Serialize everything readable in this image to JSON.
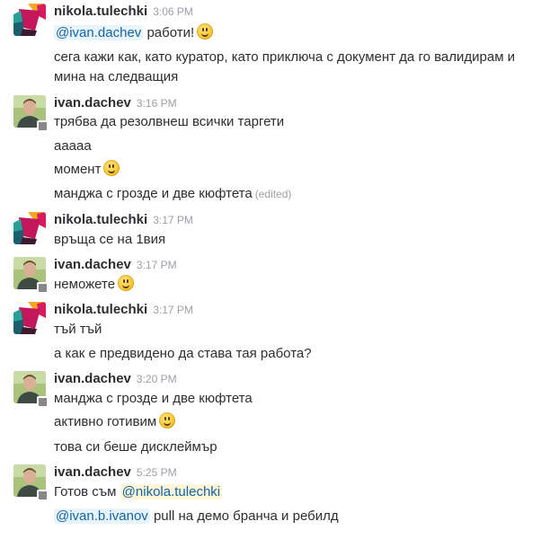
{
  "users": {
    "nikola": "nikola.tulechki",
    "ivan": "ivan.dachev"
  },
  "groups": [
    {
      "time": "3:06 PM",
      "lines": [
        {
          "mention": "@ivan.dachev",
          "text": " работи!",
          "emoji": "slightly-smiling-face"
        },
        {
          "text": "сега кажи как, като куратор, като приключа с документ да го валидирам и мина на следващия"
        }
      ]
    },
    {
      "time": "3:16 PM",
      "lines": [
        {
          "text": "трябва да резолвнеш всички таргети"
        },
        {
          "text": "ааааа"
        },
        {
          "text": "момент",
          "emoji": "slightly-smiling-face"
        },
        {
          "text": "манджа с грозде и две кюфтета",
          "edited": "(edited)"
        }
      ]
    },
    {
      "time": "3:17 PM",
      "lines": [
        {
          "text": "връща се на 1вия"
        }
      ]
    },
    {
      "time": "3:17 PM",
      "lines": [
        {
          "text": "неможете",
          "emoji": "slightly-smiling-face"
        }
      ]
    },
    {
      "time": "3:17 PM",
      "lines": [
        {
          "text": "тъй тъй"
        },
        {
          "text": "а как е предвидено да става тая работа?"
        }
      ]
    },
    {
      "time": "3:20 PM",
      "lines": [
        {
          "text": "манджа с грозде и две кюфтета"
        },
        {
          "text": "активно готивим",
          "emoji": "slightly-smiling-face"
        },
        {
          "text": "това си беше дисклеймър"
        }
      ]
    },
    {
      "time": "5:25 PM",
      "lines": [
        {
          "text": "Готов съм ",
          "mention": "@nikola.tulechki"
        },
        {
          "mention": "@ivan.b.ivanov",
          "text": " pull на демо бранча и ребилд"
        }
      ]
    }
  ],
  "colors": {
    "mention_text": "#1264a3",
    "mention_bg": "#e8f4fb",
    "mention_highlight_bg": "#fdf5d6",
    "presence_away": "#888888",
    "timestamp": "#9e9ea6"
  }
}
